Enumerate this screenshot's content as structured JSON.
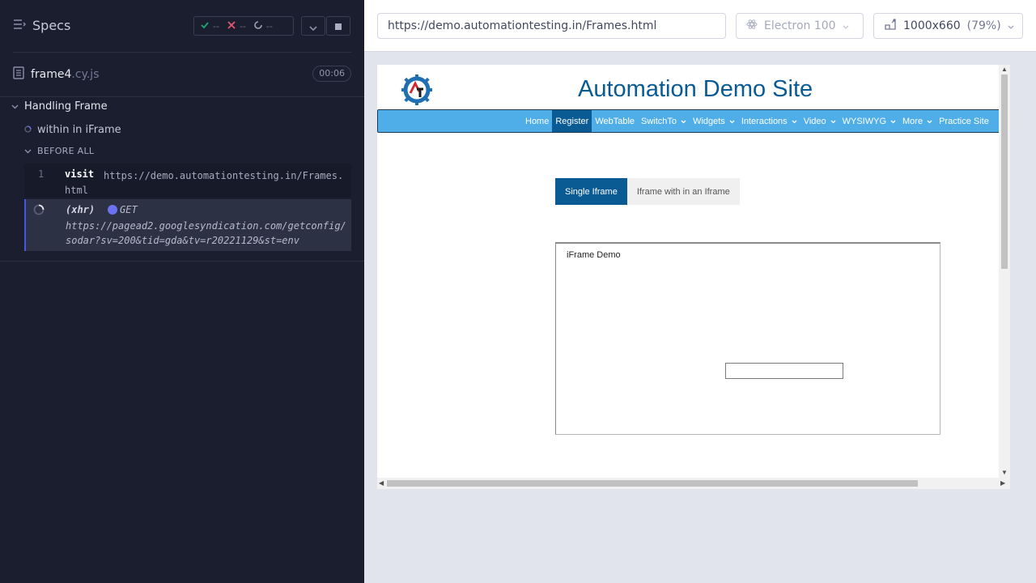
{
  "reporter": {
    "header": {
      "title": "Specs"
    },
    "stats": {
      "passed": "--",
      "failed": "--",
      "pending": "--"
    },
    "spec": {
      "name": "frame4",
      "ext": ".cy.js",
      "duration": "00:06"
    },
    "suite": {
      "title": "Handling Frame"
    },
    "test": {
      "title": "within in iFrame"
    },
    "hook": {
      "title": "BEFORE ALL"
    },
    "commands": [
      {
        "number": "1",
        "name": "visit",
        "message": "https://demo.automationtesting.in/Frames.html"
      },
      {
        "number": "",
        "name": "(xhr)",
        "method": "GET",
        "message": "https://pagead2.googlesyndication.com/getconfig/sodar?sv=200&tid=gda&tv=r20221129&st=env"
      }
    ]
  },
  "browser": {
    "url": "https://demo.automationtesting.in/Frames.html",
    "browser_name": "Electron 100",
    "viewport": "1000x660",
    "zoom": "(79%)"
  },
  "site": {
    "title": "Automation Demo Site",
    "nav": [
      {
        "label": "Home"
      },
      {
        "label": "Register",
        "active": true
      },
      {
        "label": "WebTable"
      },
      {
        "label": "SwitchTo",
        "dropdown": true
      },
      {
        "label": "Widgets",
        "dropdown": true
      },
      {
        "label": "Interactions",
        "dropdown": true
      },
      {
        "label": "Video",
        "dropdown": true
      },
      {
        "label": "WYSIWYG",
        "dropdown": true
      },
      {
        "label": "More",
        "dropdown": true
      },
      {
        "label": "Practice Site"
      }
    ],
    "tabs": [
      {
        "label": "Single Iframe",
        "active": true
      },
      {
        "label": "Iframe with in an Iframe"
      }
    ],
    "iframe_heading": "iFrame Demo"
  },
  "colors": {
    "reporter_bg": "#1b1e2e",
    "site_primary": "#0a5a94",
    "navbar": "#4faee8",
    "pass": "#1fa971",
    "fail": "#e45770",
    "running": "#6c73f3"
  },
  "icons": [
    "specs-list-icon",
    "check-icon",
    "x-icon",
    "spinner-icon",
    "chevron-down-icon",
    "stop-icon",
    "document-icon",
    "electron-icon",
    "viewport-icon",
    "site-logo"
  ]
}
